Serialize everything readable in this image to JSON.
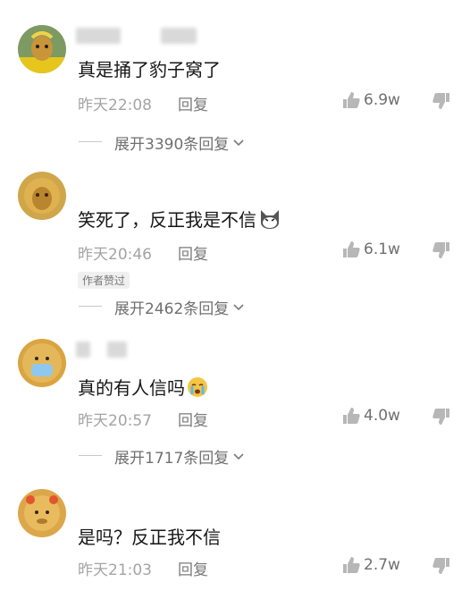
{
  "comments": [
    {
      "text": "真是捅了豹子窝了",
      "time": "昨天22:08",
      "reply": "回复",
      "likes": "6.9w",
      "expand": "展开3390条回复"
    },
    {
      "text": "笑死了，反正我是不信",
      "time": "昨天20:46",
      "reply": "回复",
      "likes": "6.1w",
      "badge": "作者赞过",
      "expand": "展开2462条回复"
    },
    {
      "text": "真的有人信吗",
      "time": "昨天20:57",
      "reply": "回复",
      "likes": "4.0w",
      "expand": "展开1717条回复"
    },
    {
      "text": "是吗？反正我不信",
      "time": "昨天21:03",
      "reply": "回复",
      "likes": "2.7w"
    }
  ],
  "colors": {
    "text": "#161616",
    "meta": "#a4a4a4",
    "secondary": "#6f6f6f",
    "avatar_gold": "#d9a441"
  },
  "icons": {
    "like": "thumbs-up-icon",
    "dislike": "thumbs-down-icon",
    "expand": "chevron-down-icon"
  }
}
